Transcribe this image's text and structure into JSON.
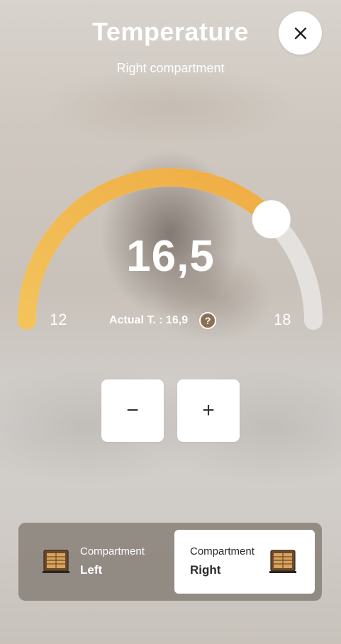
{
  "header": {
    "title": "Temperature",
    "subtitle": "Right compartment",
    "close_icon": "close-icon"
  },
  "gauge": {
    "value_display": "16,5",
    "value": 16.5,
    "min": 12,
    "max": 18,
    "min_label": "12",
    "max_label": "18",
    "actual_label": "Actual T. : 16,9",
    "help_symbol": "?",
    "active_color": "#f0b448",
    "track_color": "#e4e1de"
  },
  "controls": {
    "minus_label": "−",
    "plus_label": "+"
  },
  "compartments": {
    "left": {
      "small_label": "Compartment",
      "big_label": "Left",
      "selected": false,
      "icon": "wine-cabinet-icon"
    },
    "right": {
      "small_label": "Compartment",
      "big_label": "Right",
      "selected": true,
      "icon": "wine-cabinet-icon"
    }
  }
}
